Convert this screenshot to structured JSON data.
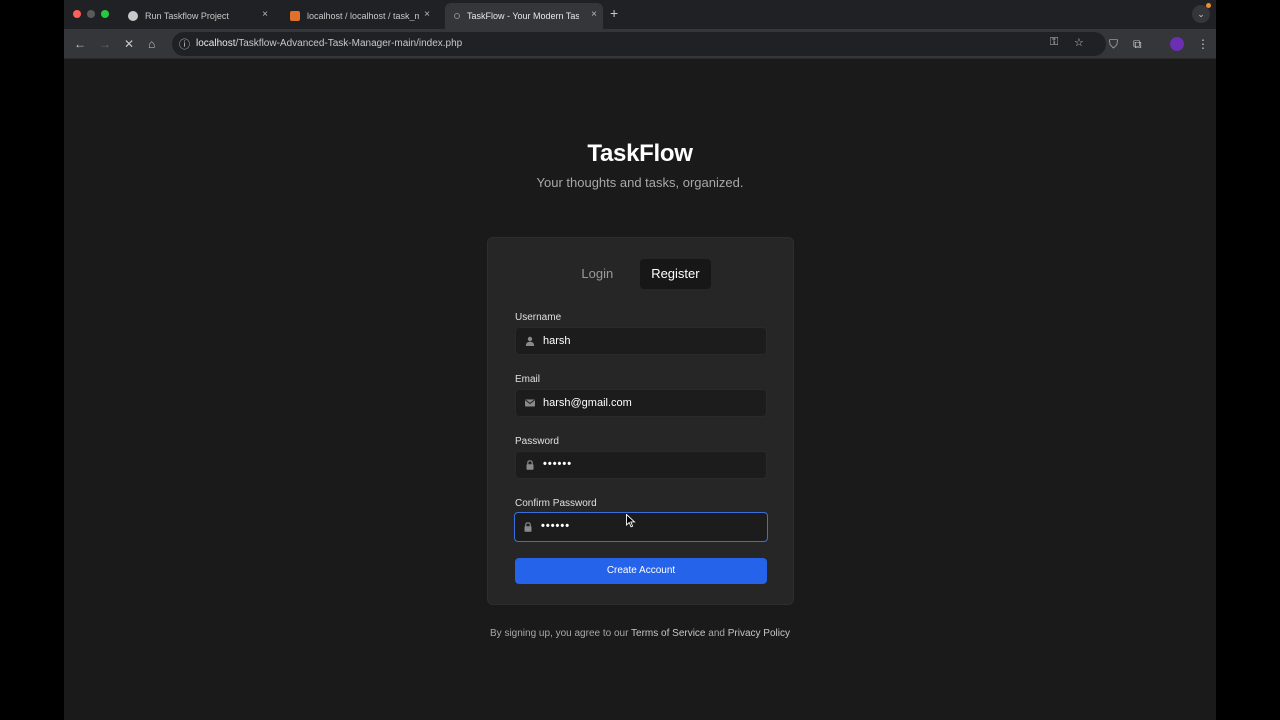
{
  "browser": {
    "tabs": [
      {
        "title": "Run Taskflow Project",
        "active": false
      },
      {
        "title": "localhost / localhost / task_m",
        "active": false
      },
      {
        "title": "TaskFlow - Your Modern Task",
        "active": true
      }
    ],
    "close_glyph": "×",
    "new_tab_glyph": "+",
    "url_host": "localhost",
    "url_path": "/Taskflow-Advanced-Task-Manager-main/index.php"
  },
  "app": {
    "brand": "TaskFlow",
    "tagline": "Your thoughts and tasks, organized."
  },
  "auth": {
    "tabs": {
      "login": "Login",
      "register": "Register"
    },
    "active_tab": "register",
    "fields": {
      "username": {
        "label": "Username",
        "value": "harsh",
        "icon": "user-icon"
      },
      "email": {
        "label": "Email",
        "value": "harsh@gmail.com",
        "icon": "mail-icon"
      },
      "password": {
        "label": "Password",
        "value": "••••••",
        "icon": "lock-icon"
      },
      "confirm": {
        "label": "Confirm Password",
        "value": "••••••",
        "icon": "lock-icon"
      }
    },
    "submit_label": "Create Account",
    "legal": {
      "prefix": "By signing up, you agree to our ",
      "terms": "Terms of Service",
      "and": " and ",
      "privacy": "Privacy Policy"
    }
  },
  "colors": {
    "page_bg": "#1a1a1a",
    "card_bg": "#262626",
    "accent": "#2563eb",
    "focus_ring": "#3b6fe0"
  }
}
